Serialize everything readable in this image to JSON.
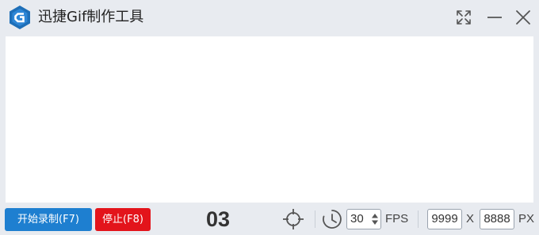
{
  "window": {
    "title": "迅捷Gif制作工具",
    "logo_icon": "app-logo-g-hexagon",
    "controls": {
      "fullscreen_icon": "expand-arrows-icon",
      "minimize_icon": "minimize-icon",
      "close_icon": "close-icon"
    }
  },
  "toolbar": {
    "start_label": "开始录制(F7)",
    "stop_label": "停止(F8)",
    "countdown": "03",
    "target_icon": "crosshair-icon",
    "clock_icon": "clock-icon",
    "fps": {
      "value": "30",
      "unit": "FPS"
    },
    "size": {
      "width": "9999",
      "separator": "X",
      "height": "8888",
      "unit": "PX"
    }
  },
  "colors": {
    "start_button": "#1e7fd0",
    "stop_button": "#e3141b",
    "background": "#e8ebf0",
    "canvas": "#ffffff",
    "logo": "#1e6fb8"
  }
}
